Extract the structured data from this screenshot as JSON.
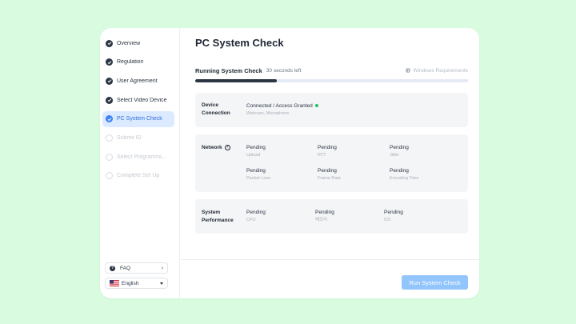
{
  "colors": {
    "background": "#d9fbe0",
    "accent": "#3b82f6",
    "progress": "#2b3544",
    "success": "#22c55e",
    "button": "#93c5fd"
  },
  "sidebar": {
    "steps": [
      {
        "label": "Overview",
        "state": "done"
      },
      {
        "label": "Regulation",
        "state": "done"
      },
      {
        "label": "User Agreement",
        "state": "done"
      },
      {
        "label": "Select Video Device",
        "state": "done"
      },
      {
        "label": "PC System Check",
        "state": "active"
      },
      {
        "label": "Submit ID",
        "state": "todo"
      },
      {
        "label": "Select Programmi...",
        "state": "todo"
      },
      {
        "label": "Complete Set Up",
        "state": "todo"
      }
    ],
    "faq_label": "FAQ",
    "language_label": "English"
  },
  "main": {
    "title": "PC System Check",
    "running_title": "Running System Check",
    "time_left": "30 seconds left",
    "requirements_link": "Windows Requirements",
    "progress": 0.3
  },
  "device": {
    "label_line1": "Device",
    "label_line2": "Connection",
    "status": "Connected / Access Granted",
    "detail": "Webcam, Microphone"
  },
  "network": {
    "label": "Network",
    "help_glyph": "?",
    "items": [
      {
        "value": "Pending",
        "name": "Upload"
      },
      {
        "value": "Pending",
        "name": "RTT"
      },
      {
        "value": "Pending",
        "name": "Jitter"
      },
      {
        "value": "Pending",
        "name": "Packet Loss"
      },
      {
        "value": "Pending",
        "name": "Frame Rate"
      },
      {
        "value": "Pending",
        "name": "Encoding Time"
      }
    ]
  },
  "performance": {
    "label_line1": "System",
    "label_line2": "Performance",
    "items": [
      {
        "value": "Pending",
        "name": "CPU"
      },
      {
        "value": "Pending",
        "name": "메모리"
      },
      {
        "value": "Pending",
        "name": "OS"
      }
    ]
  },
  "footer": {
    "run_button": "Run System Check"
  }
}
